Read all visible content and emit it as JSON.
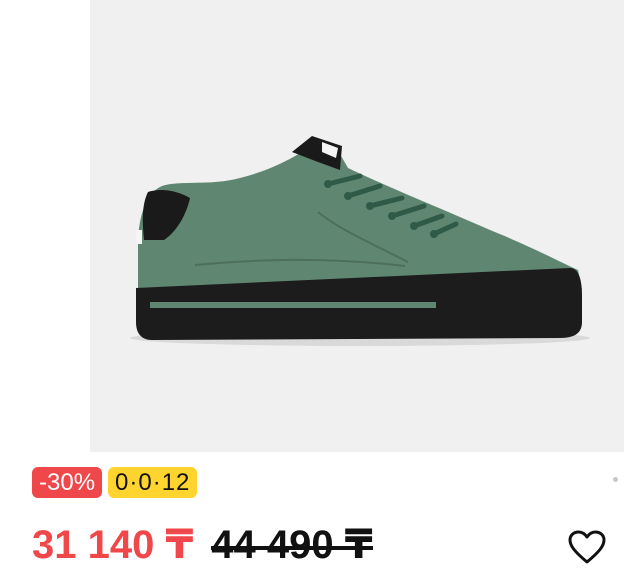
{
  "product": {
    "image_icon": "sneaker-image",
    "badges": {
      "discount": "-30%",
      "installment": "0·0·12"
    },
    "price": {
      "current": "31 140 ₸",
      "old": "44 490 ₸"
    },
    "favorite_icon": "heart-outline-icon"
  },
  "colors": {
    "discount_badge": "#f0484a",
    "installment_badge": "#ffd42e",
    "current_price": "#f0484a",
    "image_background": "#f0f0f0"
  }
}
